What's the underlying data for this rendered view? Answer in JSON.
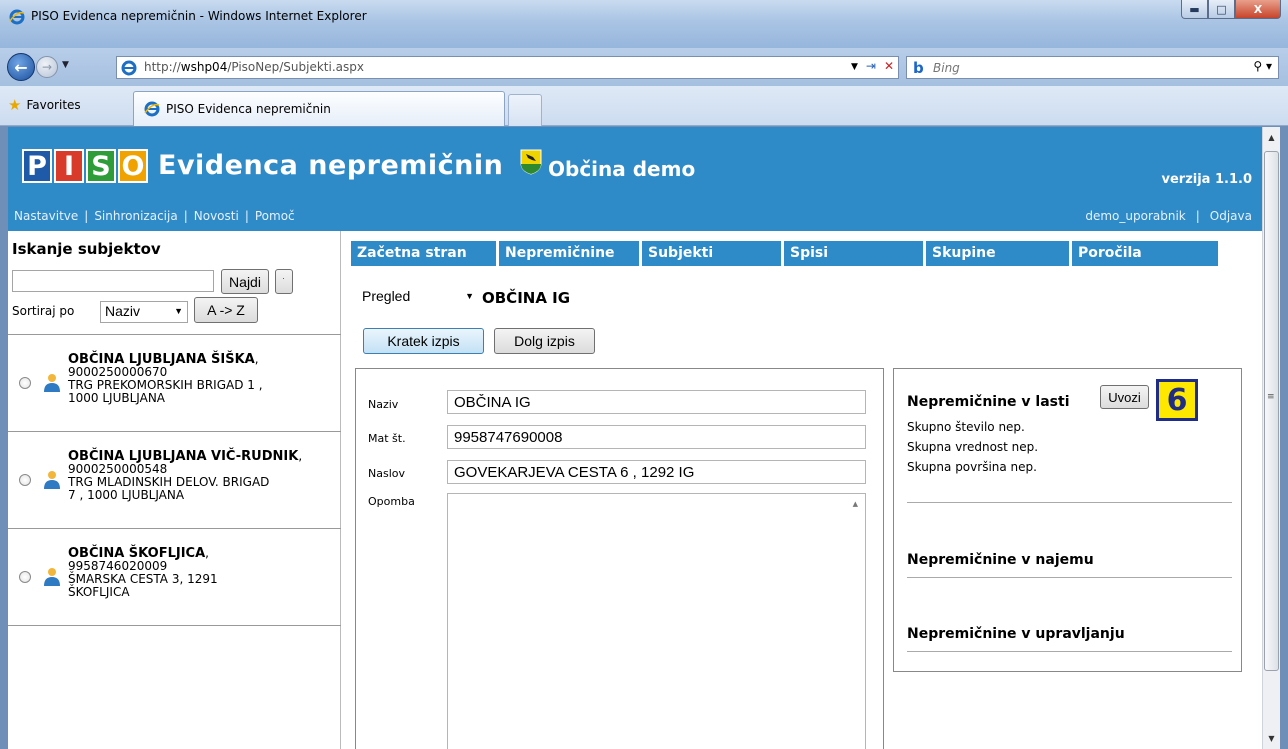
{
  "browser": {
    "title": "PISO Evidenca nepremičnin - Windows Internet Explorer",
    "url_prefix": "http://",
    "url_host": "wshp04",
    "url_path": "/PisoNep/Subjekti.aspx",
    "search_placeholder": "Bing",
    "favorites_label": "Favorites",
    "tab_label": "PISO Evidenca nepremičnin"
  },
  "header": {
    "logo_letters": [
      "P",
      "I",
      "S",
      "O"
    ],
    "logo_colors": [
      "#1f5aa8",
      "#d93b2b",
      "#2f9c3a",
      "#f0a300"
    ],
    "app_title": "Evidenca nepremičnin",
    "municipality": "Občina demo",
    "version": "verzija 1.1.0",
    "top_links": [
      "Nastavitve",
      "Sinhronizacija",
      "Novosti",
      "Pomoč"
    ],
    "user": "demo_uporabnik",
    "logout": "Odjava"
  },
  "sidebar": {
    "title": "Iskanje subjektov",
    "find_button": "Najdi",
    "sort_label": "Sortiraj po",
    "sort_value": "Naziv",
    "sort_dir_button": "A -> Z",
    "subjects": [
      {
        "name": "OBČINA LJUBLJANA ŠIŠKA",
        "id": "9000250000670",
        "addr1": "TRG PREKOMORSKIH BRIGAD 1 ,",
        "addr2": "1000 LJUBLJANA"
      },
      {
        "name": "OBČINA LJUBLJANA VIČ-RUDNIK",
        "id": "9000250000548",
        "addr1": "TRG MLADINSKIH DELOV. BRIGAD",
        "addr2": "7 , 1000 LJUBLJANA"
      },
      {
        "name": "OBČINA ŠKOFLJICA",
        "id": "9958746020009",
        "addr1": "ŠMARSKA CESTA 3, 1291",
        "addr2": "ŠKOFLJICA"
      }
    ]
  },
  "menu": [
    "Začetna stran",
    "Nepremičnine",
    "Subjekti",
    "Spisi",
    "Skupine",
    "Poročila"
  ],
  "detail": {
    "view_select": "Pregled",
    "entity_title": "OBČINA IG",
    "short_print_button": "Kratek izpis",
    "long_print_button": "Dolg izpis",
    "fields": {
      "naziv_label": "Naziv",
      "naziv_value": "OBČINA IG",
      "mat_label": "Mat št.",
      "mat_value": "9958747690008",
      "naslov_label": "Naslov",
      "naslov_value": "GOVEKARJEVA CESTA 6 , 1292 IG",
      "opomba_label": "Opomba",
      "opomba_value": ""
    }
  },
  "properties": {
    "owned_title": "Nepremičnine v lasti",
    "import_button": "Uvozi",
    "badge": "6",
    "stats": [
      "Skupno število nep.",
      "Skupna vrednost nep.",
      "Skupna površina nep."
    ],
    "rented_title": "Nepremičnine v najemu",
    "managed_title": "Nepremičnine v upravljanju"
  }
}
